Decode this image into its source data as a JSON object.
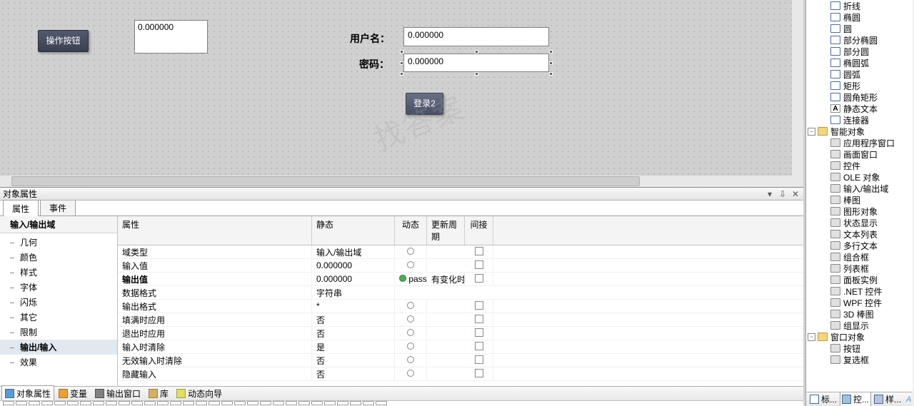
{
  "canvas": {
    "op_button": "操作按钮",
    "io1_value": "0.000000",
    "user_label": "用户名：",
    "pass_label": "密码：",
    "io_user_value": "0.000000",
    "io_pass_value": "0.000000",
    "login_button": "登录2",
    "watermark": "找答案"
  },
  "prop_panel": {
    "title": "对象属性",
    "tabs": {
      "props": "属性",
      "events": "事件"
    },
    "category_header": "输入/输出域",
    "categories": [
      {
        "label": "几何",
        "bold": false
      },
      {
        "label": "颜色",
        "bold": false
      },
      {
        "label": "样式",
        "bold": false
      },
      {
        "label": "字体",
        "bold": false
      },
      {
        "label": "闪烁",
        "bold": false
      },
      {
        "label": "其它",
        "bold": false
      },
      {
        "label": "限制",
        "bold": false
      },
      {
        "label": "输出/输入",
        "bold": true
      },
      {
        "label": "效果",
        "bold": false
      }
    ],
    "cols": {
      "attr": "属性",
      "static": "静态",
      "dyn": "动态",
      "upd": "更新周期",
      "ind": "间接"
    },
    "rows": [
      {
        "attr": "域类型",
        "static": "输入/输出域",
        "dyn": "bulb",
        "upd": "",
        "ind": true
      },
      {
        "attr": "输入值",
        "static": "0.000000",
        "dyn": "bulb",
        "upd": "",
        "ind": true
      },
      {
        "attr": "输出值",
        "static": "0.000000",
        "dyn": "green",
        "upd_tag": "passwo",
        "upd_cycle": "有变化时",
        "ind": true,
        "bold": true
      },
      {
        "attr": "数据格式",
        "static": "字符串",
        "dyn": "",
        "upd": "",
        "ind": false
      },
      {
        "attr": "输出格式",
        "static": "*",
        "dyn": "bulb",
        "upd": "",
        "ind": true
      },
      {
        "attr": "填满时应用",
        "static": "否",
        "dyn": "bulb",
        "upd": "",
        "ind": true
      },
      {
        "attr": "退出时应用",
        "static": "否",
        "dyn": "bulb",
        "upd": "",
        "ind": true
      },
      {
        "attr": "输入时清除",
        "static": "是",
        "dyn": "bulb",
        "upd": "",
        "ind": true
      },
      {
        "attr": "无效输入时清除",
        "static": "否",
        "dyn": "bulb",
        "upd": "",
        "ind": true
      },
      {
        "attr": "隐藏输入",
        "static": "否",
        "dyn": "bulb",
        "upd": "",
        "ind": true
      }
    ]
  },
  "btm_tabs": [
    {
      "label": "对象属性",
      "active": true
    },
    {
      "label": "变量",
      "active": false
    },
    {
      "label": "输出窗口",
      "active": false
    },
    {
      "label": "库",
      "active": false
    },
    {
      "label": "动态向导",
      "active": false
    }
  ],
  "palette": {
    "group_smart": "智能对象",
    "group_window": "窗口对象",
    "shapes": [
      "折线",
      "椭圆",
      "圆",
      "部分椭圆",
      "部分圆",
      "椭圆弧",
      "圆弧",
      "矩形",
      "圆角矩形",
      "静态文本",
      "连接器"
    ],
    "smart": [
      "应用程序窗口",
      "画面窗口",
      "控件",
      "OLE 对象",
      "输入/输出域",
      "棒图",
      "图形对象",
      "状态显示",
      "文本列表",
      "多行文本",
      "组合框",
      "列表框",
      "面板实例",
      ".NET 控件",
      "WPF 控件",
      "3D 棒图",
      "组显示"
    ],
    "window": [
      "按钮",
      "复选框"
    ]
  },
  "right_tabs": {
    "std": "标...",
    "ctrl": "控...",
    "style": "样..."
  }
}
